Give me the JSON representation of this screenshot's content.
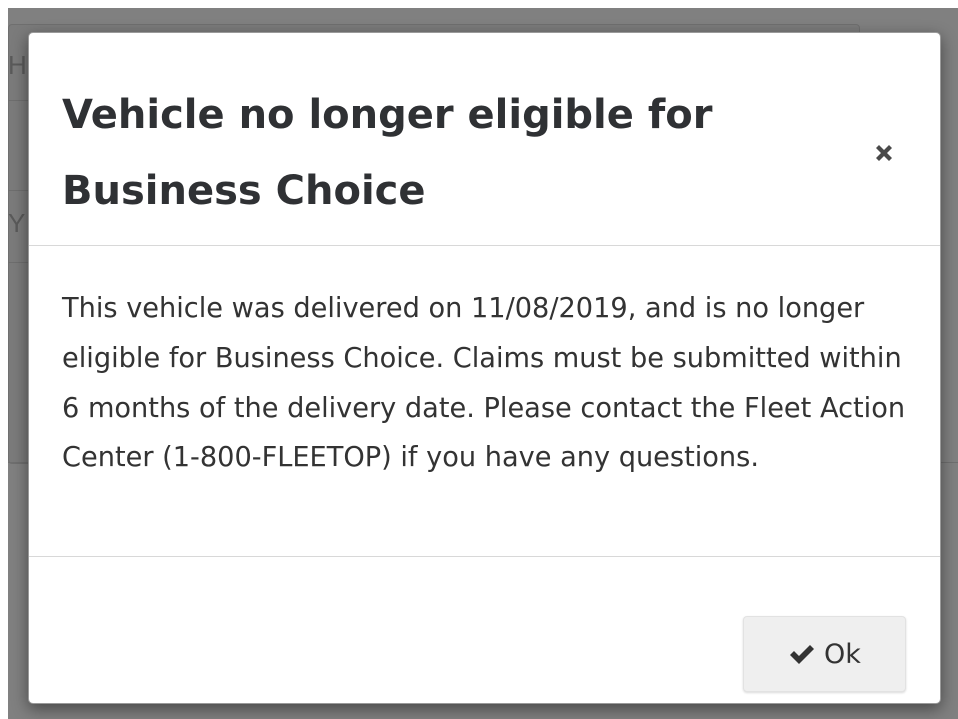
{
  "background_page": {
    "clipped_chars": [
      "H",
      "Y"
    ]
  },
  "modal": {
    "title": "Vehicle no longer eligible for Business Choice",
    "close_icon": "close-icon",
    "body": "This vehicle was delivered on 11/08/2019, and is no longer eligible for Business Choice. Claims must be submitted within 6 months of the delivery date. Please contact the Fleet Action Center (1-800-FLEETOP) if you have any questions.",
    "ok_button": {
      "icon": "check-icon",
      "label": "Ok"
    }
  },
  "colors": {
    "backdrop": "#808080",
    "title_text": "#2f3134",
    "body_text": "#333333",
    "button_bg": "#efefef"
  }
}
